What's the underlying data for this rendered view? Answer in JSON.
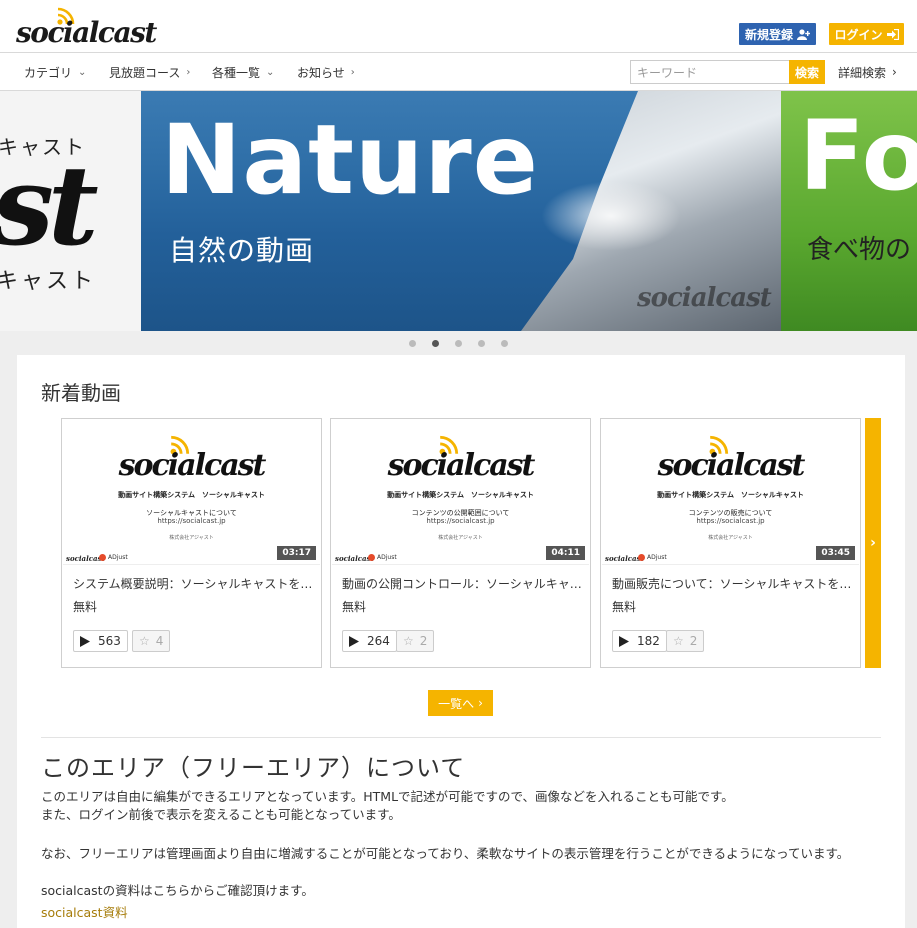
{
  "header": {
    "logo_text": "socialcast",
    "register_label": "新規登録",
    "login_label": "ログイン"
  },
  "nav": {
    "items": [
      {
        "label": "カテゴリ",
        "chevron": "⌄"
      },
      {
        "label": "見放題コース",
        "chevron": "›"
      },
      {
        "label": "各種一覧",
        "chevron": "⌄"
      },
      {
        "label": "お知らせ",
        "chevron": "›"
      }
    ],
    "search_placeholder": "キーワード",
    "search_button": "検索",
    "advanced_search": "詳細検索"
  },
  "carousel": {
    "left": {
      "kana_top": "キャスト",
      "big": "st",
      "kana_bottom": "キャスト"
    },
    "main": {
      "title": "Nature",
      "subtitle": "自然の動画",
      "watermark": "socialcast"
    },
    "right": {
      "title": "Fo",
      "subtitle": "食べ物の"
    },
    "dots": 5,
    "active_dot": 1
  },
  "new_videos": {
    "title": "新着動画",
    "cards": [
      {
        "thumb_logo": "socialcast",
        "thumb_line1": "動画サイト構築システム　ソーシャルキャスト",
        "thumb_line2": "ソーシャルキャストについて",
        "thumb_line3": "https://socialcast.jp",
        "thumb_line4": "株式会社アジャスト",
        "duration": "03:17",
        "title": "システム概要説明：ソーシャルキャストを動...",
        "price": "無料",
        "views": "563",
        "stars": "4"
      },
      {
        "thumb_logo": "socialcast",
        "thumb_line1": "動画サイト構築システム　ソーシャルキャスト",
        "thumb_line2": "コンテンツの公開範囲について",
        "thumb_line3": "https://socialcast.jp",
        "thumb_line4": "株式会社アジャスト",
        "duration": "04:11",
        "title": "動画の公開コントロール：ソーシャルキャス...",
        "price": "無料",
        "views": "264",
        "stars": "2"
      },
      {
        "thumb_logo": "socialcast",
        "thumb_line1": "動画サイト構築システム　ソーシャルキャスト",
        "thumb_line2": "コンテンツの販売について",
        "thumb_line3": "https://socialcast.jp",
        "thumb_line4": "株式会社アジャスト",
        "duration": "03:45",
        "title": "動画販売について：ソーシャルキャストを動...",
        "price": "無料",
        "views": "182",
        "stars": "2"
      }
    ],
    "list_button": "一覧へ",
    "corner_logo": "socialcast",
    "corner_brand": "ADjust"
  },
  "free_area": {
    "title": "このエリア（フリーエリア）について",
    "p1": "このエリアは自由に編集ができるエリアとなっています。HTMLで記述が可能ですので、画像などを入れることも可能です。",
    "p2": "また、ログイン前後で表示を変えることも可能となっています。",
    "p3": "なお、フリーエリアは管理画面より自由に増減することが可能となっており、柔軟なサイトの表示管理を行うことができるようになっています。",
    "p4": "socialcastの資料はこちらからご確認頂けます。",
    "link": "socialcast資料"
  },
  "colors": {
    "accent": "#f5b400",
    "register": "#2e63b0",
    "link": "#a67c0a"
  }
}
